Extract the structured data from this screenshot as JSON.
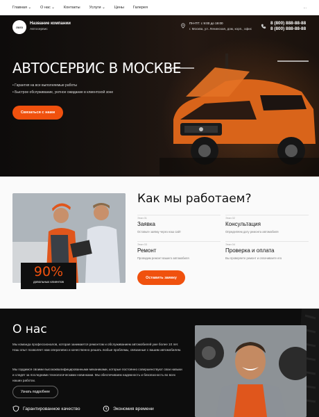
{
  "nav": {
    "items": [
      "Главная ⌄",
      "О нас ⌄",
      "Контакты",
      "Услуги ⌄",
      "Цены",
      "Галерея"
    ],
    "more": "..."
  },
  "header": {
    "logo": "лого",
    "company_name": "Название компании",
    "company_sub": "Автосервис",
    "hours": "ПН-ПТ: с 9:00 до 19:00",
    "address": "г. Москва, ул. Ленинская, дом, корп., офис",
    "phone1": "8 (800) 888-88-88",
    "phone2": "8 (800) 888-88-88"
  },
  "hero": {
    "title": "АВТОСЕРВИС В МОСКВЕ",
    "bullets": [
      "Гарантия на все выполняемые работы",
      "Быстрое обслуживание, уютное ожидание в клиентской зоне"
    ],
    "cta": "Связаться с нами"
  },
  "how": {
    "title": "Как мы работаем?",
    "badge_number": "90%",
    "badge_text": "довольных клиентов",
    "steps": [
      {
        "num": "Этап 01",
        "name": "Заявка",
        "desc": "Оставьте заявку через наш сайт"
      },
      {
        "num": "Этап 02",
        "name": "Консультация",
        "desc": "Определяем дату ремонта автомобиля"
      },
      {
        "num": "Этап 03",
        "name": "Ремонт",
        "desc": "Проводим ремонт вашего автомобиля"
      },
      {
        "num": "Этап 04",
        "name": "Проверка и оплата",
        "desc": "Вы проверяете ремонт и оплачиваете его"
      }
    ],
    "button": "Оставить заявку"
  },
  "about": {
    "title": "О нас",
    "p1": "Мы команда профессионалов, которая занимается ремонтом и обслуживанием автомобилей уже более 10 лет. Наш опыт позволяет нам оперативно и качественно решать любые проблемы, связанные с вашим автомобилем.",
    "p2": "Мы гордимся своими высококвалифицированными механиками, которые постоянно совершенствуют свои навыки и следят за последними технологическими новинками. Мы обеспечиваем надежность и безопасность во всех наших работах.",
    "button": "Узнать подробнее",
    "features": [
      "Гарантированное качество",
      "Экономия времени"
    ]
  },
  "colors": {
    "accent": "#f0510e",
    "dark": "#0d0d0d"
  }
}
